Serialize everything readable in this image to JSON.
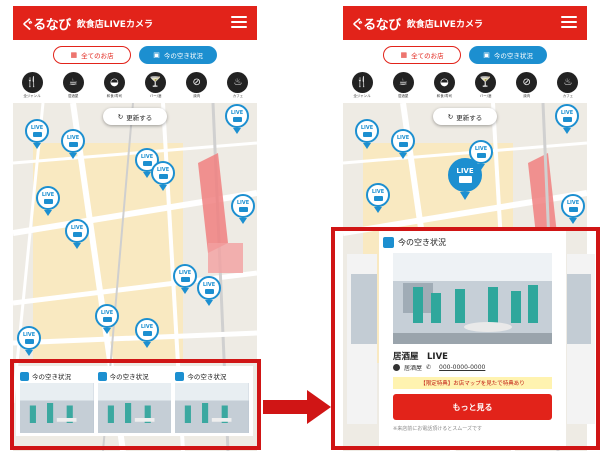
{
  "app": {
    "logo": "ぐるなび",
    "title": "飲食店LIVEカメラ"
  },
  "tabs": {
    "all": "全てのお店",
    "status": "今の空き状況"
  },
  "categories": [
    {
      "icon": "utensils",
      "label": "全ジャンル"
    },
    {
      "icon": "coffee",
      "label": "居酒屋"
    },
    {
      "icon": "sushi",
      "label": "和食/寿司"
    },
    {
      "icon": "cocktail",
      "label": "バー/酒"
    },
    {
      "icon": "meat",
      "label": "焼肉"
    },
    {
      "icon": "cafe",
      "label": "カフェ"
    }
  ],
  "map": {
    "refresh_label": "更新する",
    "pin_label": "LIVE"
  },
  "left_cards": [
    {
      "title": "今の空き状況"
    },
    {
      "title": "今の空き状況"
    },
    {
      "title": "今の空き状況"
    }
  ],
  "popup": {
    "title": "今の空き状況",
    "shop_name": "居酒屋　LIVE",
    "genre": "居酒屋",
    "phone": "000-0000-0000",
    "promo": "【限定特典】お店マップを見たで特典あり",
    "more_button": "もっと見る",
    "note": "※来店前にお電話頂けるとスムーズです"
  },
  "colors": {
    "brand_red": "#e2231a",
    "accent_blue": "#1c8fd0",
    "highlight_red": "#d01515"
  }
}
